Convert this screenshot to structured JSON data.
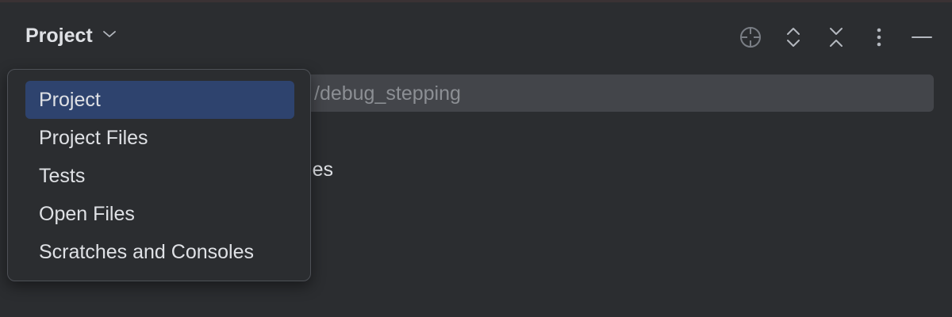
{
  "panel": {
    "title": "Project",
    "view_selector_icon": "chevron-down-icon"
  },
  "toolbar": {
    "icons": [
      "locate-icon",
      "expand-all-icon",
      "collapse-all-icon",
      "more-options-icon",
      "hide-icon"
    ]
  },
  "path_bar": {
    "text": "/debug_stepping"
  },
  "tree": {
    "partial_label": "es"
  },
  "view_menu": {
    "items": [
      {
        "label": "Project",
        "selected": true
      },
      {
        "label": "Project Files",
        "selected": false
      },
      {
        "label": "Tests",
        "selected": false
      },
      {
        "label": "Open Files",
        "selected": false
      },
      {
        "label": "Scratches and Consoles",
        "selected": false
      }
    ]
  },
  "colors": {
    "background": "#2b2d30",
    "selection": "#2e436e",
    "path_bar": "#43454a",
    "text": "#dfe1e5",
    "muted_text": "#8c8f94"
  }
}
